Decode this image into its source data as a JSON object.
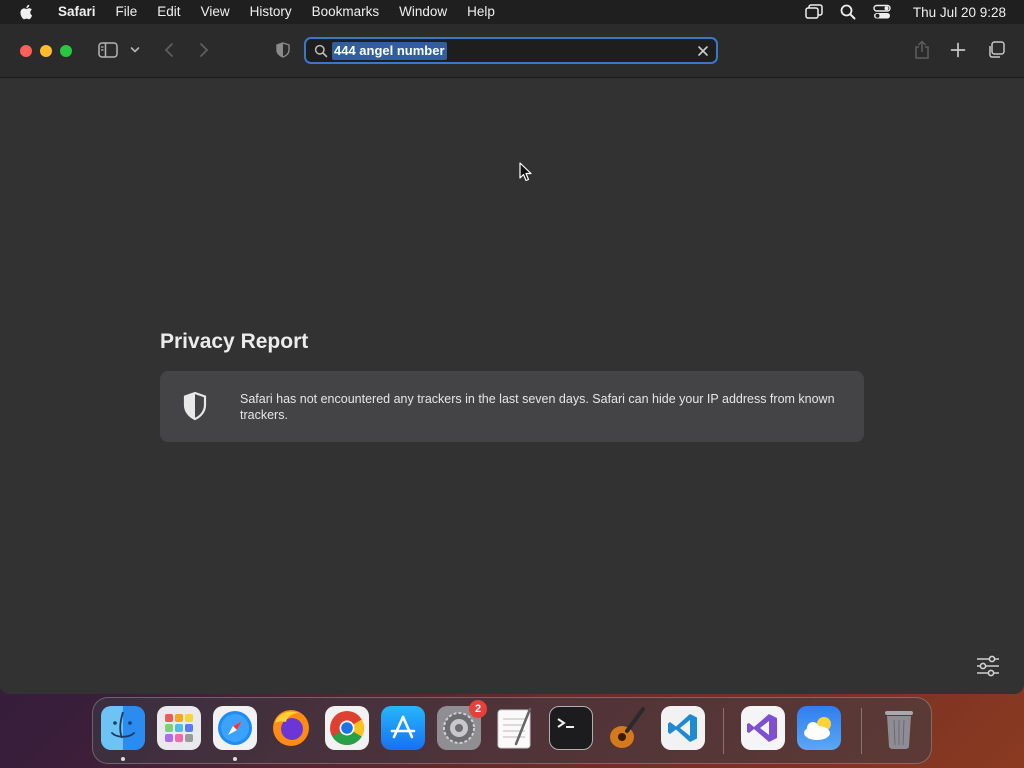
{
  "menubar": {
    "app_name": "Safari",
    "items": [
      "File",
      "Edit",
      "View",
      "History",
      "Bookmarks",
      "Window",
      "Help"
    ],
    "clock": "Thu Jul 20  9:28"
  },
  "address_bar": {
    "value": "444 angel number"
  },
  "privacy_report": {
    "title": "Privacy Report",
    "message": "Safari has not encountered any trackers in the last seven days. Safari can hide your IP address from known trackers."
  },
  "dock": {
    "apps": [
      "Finder",
      "Launchpad",
      "Safari",
      "Firefox",
      "Google Chrome",
      "App Store",
      "System Settings",
      "TextEdit",
      "Terminal",
      "GarageBand",
      "Visual Studio Code",
      "Visual Studio",
      "Weather",
      "Trash"
    ],
    "system_settings_badge": "2"
  },
  "colors": {
    "accent": "#3a78c7",
    "badge": "#e5413a"
  }
}
